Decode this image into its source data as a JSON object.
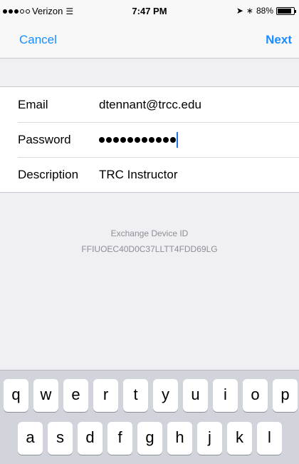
{
  "status_bar": {
    "carrier": "Verizon",
    "time": "7:47 PM",
    "battery_percent": "88%",
    "battery_level": 0.88
  },
  "nav": {
    "cancel_label": "Cancel",
    "next_label": "Next"
  },
  "form": {
    "email_label": "Email",
    "email_value": "dtennant@trcc.edu",
    "password_label": "Password",
    "password_masked_length": 11,
    "description_label": "Description",
    "description_value": "TRC Instructor"
  },
  "device": {
    "label": "Exchange Device ID",
    "id": "FFIUOEC40D0C37LLTT4FDD69LG"
  },
  "keyboard": {
    "row1": [
      "q",
      "w",
      "e",
      "r",
      "t",
      "y",
      "u",
      "i",
      "o",
      "p"
    ],
    "row2": [
      "a",
      "s",
      "d",
      "f",
      "g",
      "h",
      "j",
      "k",
      "l"
    ]
  },
  "colors": {
    "accent": "#1a8cff",
    "background": "#efeff4",
    "caret": "#1a73e8"
  }
}
